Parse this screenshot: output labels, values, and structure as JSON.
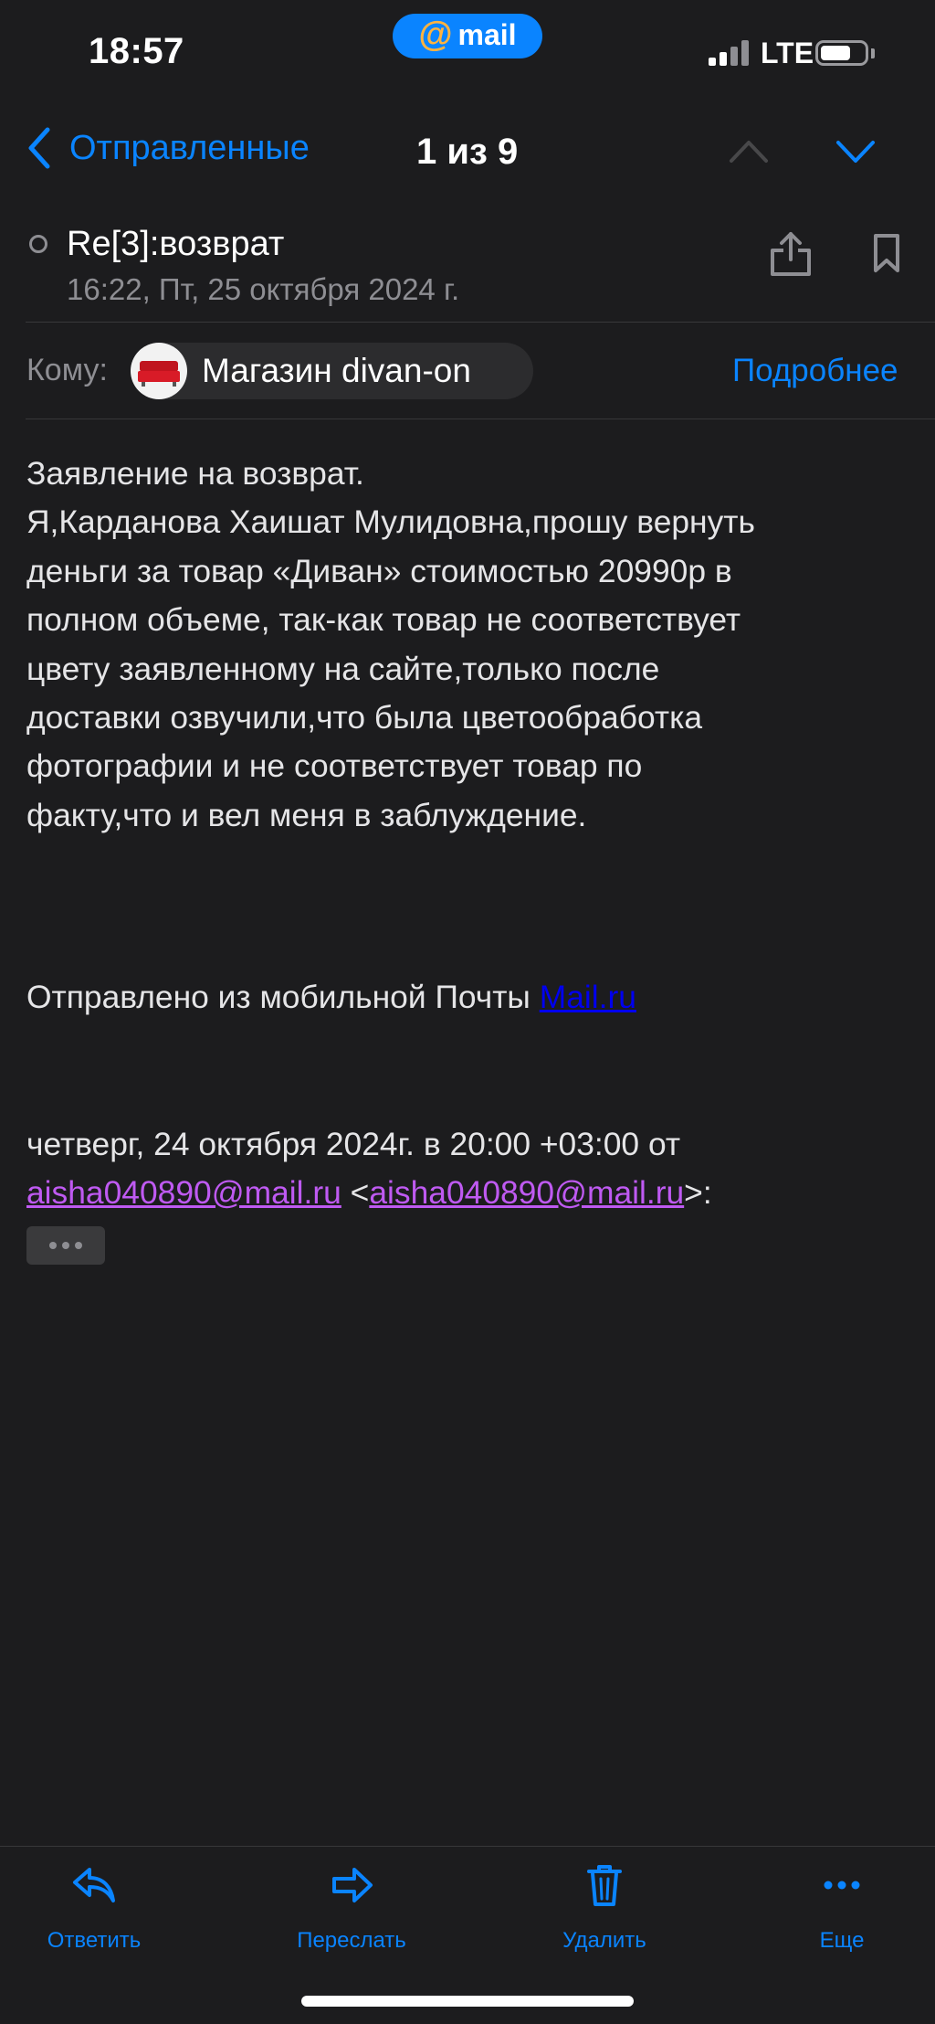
{
  "status_bar": {
    "time": "18:57",
    "app_pill_at": "@",
    "app_pill_label": "mail",
    "network": "LTE"
  },
  "nav": {
    "back_label": "Отправленные",
    "counter": "1 из 9",
    "accent_color": "#0a84ff"
  },
  "message": {
    "subject": "Re[3]:возврат",
    "date": "16:22, Пт, 25 октября 2024 г.",
    "to_label": "Кому:",
    "recipient": "Магазин divan-on",
    "details_label": "Подробнее",
    "body_lines": [
      "Заявление на возврат.",
      "Я,Карданова Хаишат Мулидовна,прошу вернуть",
      "деньги за товар «Диван» стоимостью 20990р в",
      "полном объеме, так-как товар не соответствует",
      "цвету заявленному на сайте,только после",
      "доставки озвучили,что была цветообработка",
      "фотографии и не соответствует товар по",
      "факту,что и вел меня в заблуждение."
    ],
    "sent_from_prefix": "Отправлено из мобильной Почты ",
    "sent_from_link": "Mail.ru",
    "quote_header": "четверг, 24 октября 2024г. в 20:00 +03:00 от",
    "quote_email": "aisha040890@mail.ru",
    "quote_email_bracketed": "aisha040890@mail.ru"
  },
  "toolbar": {
    "reply": "Ответить",
    "forward": "Переслать",
    "delete": "Удалить",
    "more": "Еще"
  }
}
